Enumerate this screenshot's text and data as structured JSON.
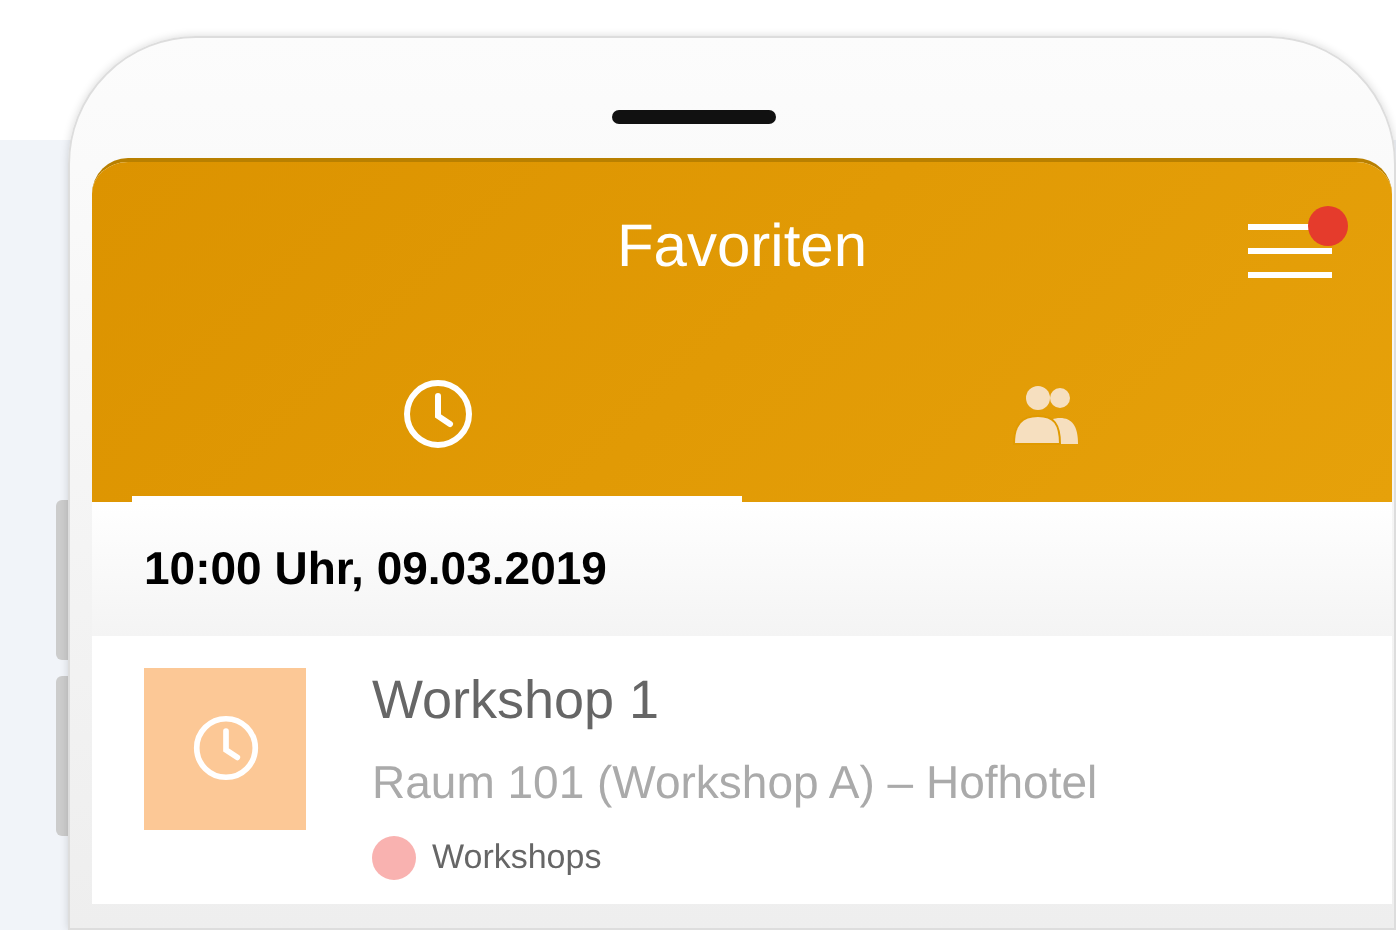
{
  "header": {
    "title": "Favoriten",
    "menu_notification": true
  },
  "tabs": [
    {
      "kind": "clock",
      "selected": true
    },
    {
      "kind": "people",
      "selected": false
    }
  ],
  "section": {
    "heading": "10:00 Uhr, 09.03.2019"
  },
  "events": [
    {
      "title": "Workshop 1",
      "location": "Raum 101 (Workshop A) – Hofhotel",
      "color": "#fcc896",
      "category": {
        "label": "Workshops",
        "color": "#f9b2b0"
      }
    }
  ]
}
